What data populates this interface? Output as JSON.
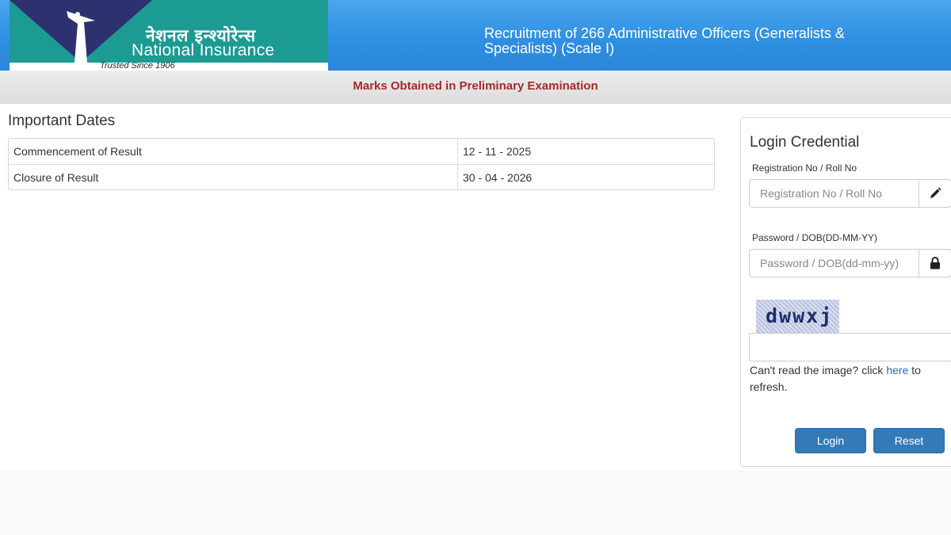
{
  "header": {
    "logo": {
      "hindi_name": "नेशनल इन्श्योरेन्स",
      "english_name": "National Insurance",
      "tagline": "Trusted Since 1906"
    },
    "recruitment_title": "Recruitment of 266 Administrative Officers (Generalists & Specialists) (Scale I)"
  },
  "subheader": {
    "title": "Marks Obtained in Preliminary Examination"
  },
  "important_dates": {
    "heading": "Important Dates",
    "rows": [
      {
        "label": "Commencement of Result",
        "value": "12 - 11 - 2025"
      },
      {
        "label": "Closure of Result",
        "value": "30 - 04 - 2026"
      }
    ]
  },
  "login": {
    "title": "Login Credential",
    "registration": {
      "label": "Registration No / Roll No",
      "placeholder": "Registration No / Roll No",
      "icon": "pencil-icon"
    },
    "password": {
      "label": "Password / DOB(DD-MM-YY)",
      "placeholder": "Password / DOB(dd-mm-yy)",
      "icon": "lock-icon"
    },
    "captcha": {
      "text": "dwwxj",
      "help_prefix": "Can't read the image? click ",
      "help_link": "here",
      "help_suffix": " to refresh."
    },
    "login_button": "Login",
    "reset_button": "Reset"
  },
  "colors": {
    "header_blue": "#2e8ee0",
    "logo_teal": "#1c9b92",
    "logo_navy": "#2e3170",
    "subheader_text": "#a52a2a",
    "button_blue": "#337ab7",
    "link_blue": "#1f6fc0"
  }
}
